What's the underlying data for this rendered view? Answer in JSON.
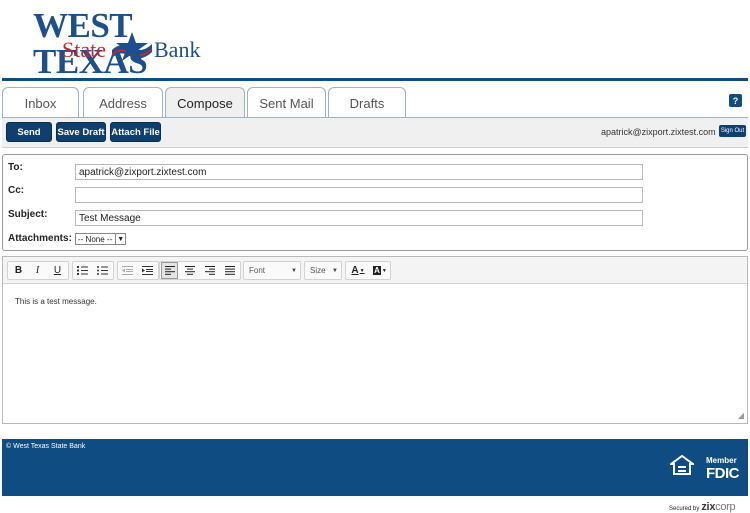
{
  "brand": {
    "line1": "WEST TEXAS",
    "line2_a": "State",
    "line2_b": "Bank",
    "blue": "#1d4f8c",
    "red": "#c8262b"
  },
  "tabs": [
    {
      "label": "Inbox",
      "active": false
    },
    {
      "label": "Address",
      "active": false
    },
    {
      "label": "Compose",
      "active": true
    },
    {
      "label": "Sent Mail",
      "active": false
    },
    {
      "label": "Drafts",
      "active": false
    }
  ],
  "help_label": "?",
  "toolbar": {
    "send": "Send",
    "save_draft": "Save Draft",
    "attach_file": "Attach File",
    "user_email": "apatrick@zixport.zixtest.com",
    "sign_out": "Sign Out"
  },
  "form": {
    "to_label": "To:",
    "to_value": "apatrick@zixport.zixtest.com",
    "cc_label": "Cc:",
    "cc_value": "",
    "subject_label": "Subject:",
    "subject_value": "Test Message",
    "attachments_label": "Attachments:",
    "attachments_selected": "-- None --"
  },
  "editor": {
    "bold": "B",
    "italic": "I",
    "underline": "U",
    "font_placeholder": "Font",
    "size_placeholder": "Size",
    "text_color": "A",
    "bg_color": "A",
    "body": "This is a test message."
  },
  "footer": {
    "copyright": "© West Texas State Bank",
    "member": "Member",
    "fdic": "FDIC",
    "ehl_label": "EQUAL HOUSING LENDER",
    "secured_by": "Secured by",
    "zix": "zix",
    "corp": "corp"
  },
  "colors": {
    "primary": "#0f4c81",
    "button": "#0f3f6e"
  }
}
